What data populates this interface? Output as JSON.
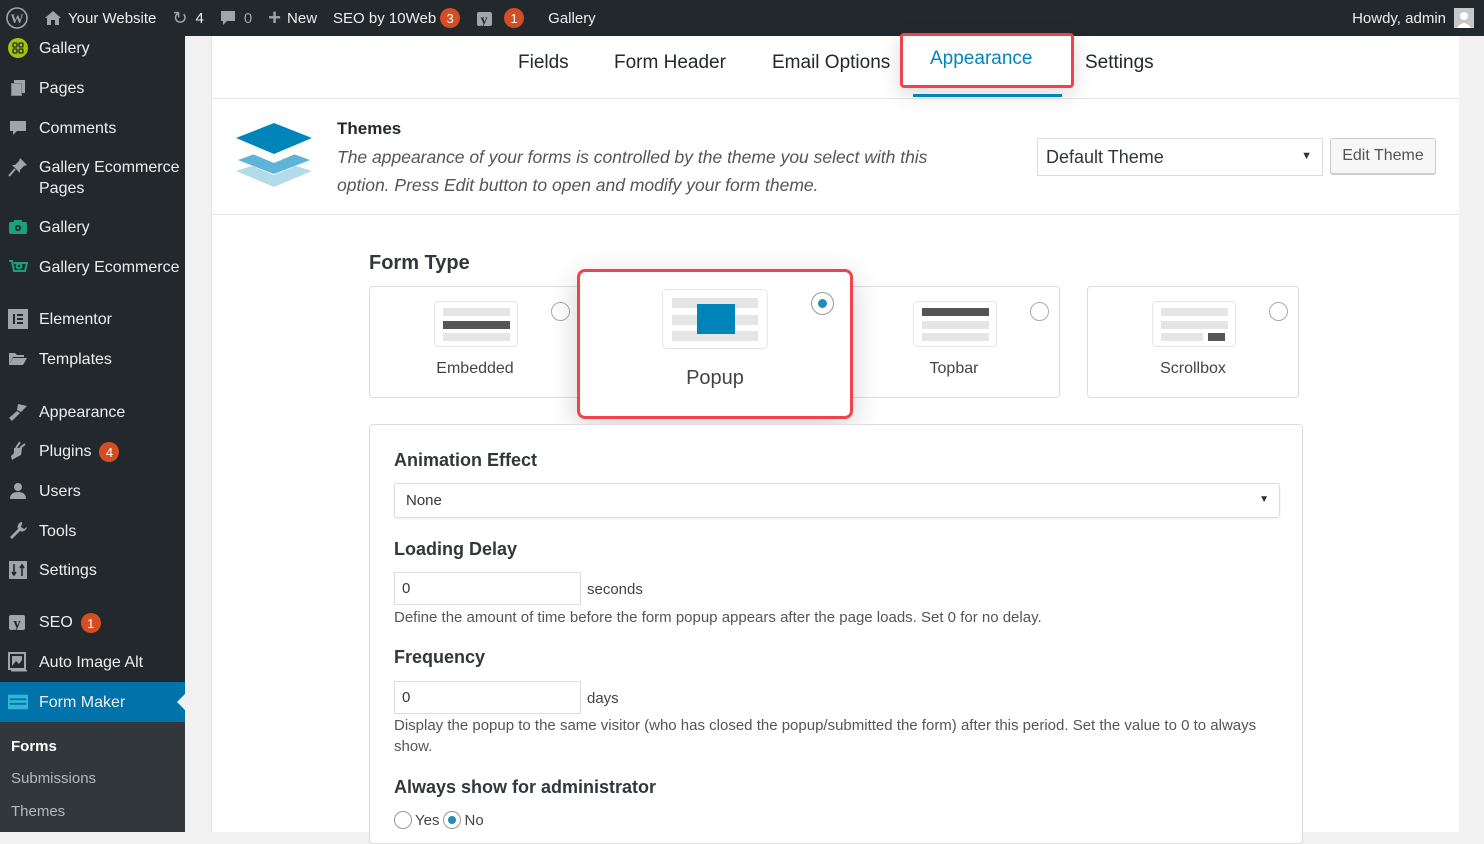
{
  "adminbar": {
    "site_name": "Your Website",
    "updates_count": "4",
    "comments_count": "0",
    "new_label": "New",
    "seo_10web_label": "SEO by 10Web",
    "seo_10web_badge": "3",
    "yoast_badge": "1",
    "gallery_label": "Gallery",
    "howdy": "Howdy, admin"
  },
  "sidebar": {
    "items": [
      {
        "label": "Gallery",
        "icon": "gallery-grid-icon"
      },
      {
        "label": "Pages",
        "icon": "pages-icon"
      },
      {
        "label": "Comments",
        "icon": "comments-icon"
      },
      {
        "label": "Gallery Ecommerce Pages",
        "icon": "pin-icon"
      },
      {
        "label": "Gallery",
        "icon": "camera-icon"
      },
      {
        "label": "Gallery Ecommerce",
        "icon": "ecommerce-icon"
      },
      {
        "label": "Elementor",
        "icon": "elementor-icon"
      },
      {
        "label": "Templates",
        "icon": "folder-icon"
      },
      {
        "label": "Appearance",
        "icon": "brush-icon"
      },
      {
        "label": "Plugins",
        "icon": "plugin-icon",
        "badge": "4"
      },
      {
        "label": "Users",
        "icon": "users-icon"
      },
      {
        "label": "Tools",
        "icon": "wrench-icon"
      },
      {
        "label": "Settings",
        "icon": "settings-icon"
      },
      {
        "label": "SEO",
        "icon": "yoast-icon",
        "badge": "1"
      },
      {
        "label": "Auto Image Alt",
        "icon": "image-alt-icon"
      },
      {
        "label": "Form Maker",
        "icon": "form-maker-icon",
        "active": true
      }
    ],
    "submenu": [
      {
        "label": "Forms",
        "current": true
      },
      {
        "label": "Submissions"
      },
      {
        "label": "Themes"
      }
    ]
  },
  "tabs": [
    {
      "label": "Fields"
    },
    {
      "label": "Form Header"
    },
    {
      "label": "Email Options"
    },
    {
      "label": "Appearance",
      "active": true
    },
    {
      "label": "Settings"
    }
  ],
  "themes": {
    "title": "Themes",
    "description": "The appearance of your forms is controlled by the theme you select with this option. Press Edit button to open and modify your form theme.",
    "selected_theme": "Default Theme",
    "edit_button": "Edit Theme"
  },
  "form_type": {
    "title": "Form Type",
    "options": [
      {
        "label": "Embedded",
        "checked": false
      },
      {
        "label": "Popup",
        "checked": true
      },
      {
        "label": "Topbar",
        "checked": false
      },
      {
        "label": "Scrollbox",
        "checked": false
      }
    ]
  },
  "options": {
    "animation_effect": {
      "title": "Animation Effect",
      "value": "None"
    },
    "loading_delay": {
      "title": "Loading Delay",
      "value": "0",
      "unit": "seconds",
      "help": "Define the amount of time before the form popup appears after the page loads. Set 0 for no delay."
    },
    "frequency": {
      "title": "Frequency",
      "value": "0",
      "unit": "days",
      "help": "Display the popup to the same visitor (who has closed the popup/submitted the form) after this period. Set the value to 0 to always show."
    },
    "always_show_admin": {
      "title": "Always show for administrator",
      "yes_label": "Yes",
      "no_label": "No",
      "selected": "No"
    }
  },
  "colors": {
    "accent": "#0085ba",
    "highlight": "#f0434b",
    "admin_dark": "#23282d",
    "badge": "#d54e21"
  }
}
